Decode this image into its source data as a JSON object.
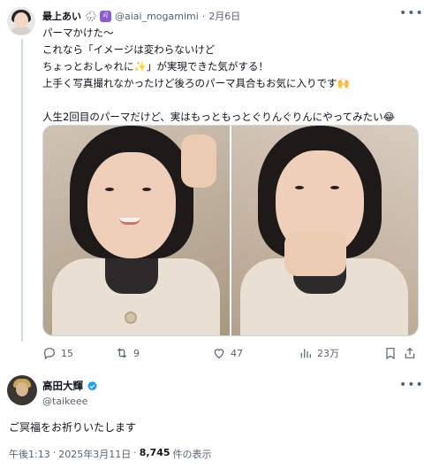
{
  "post": {
    "display_name": "最上あい",
    "emoji_a": "🌧",
    "emoji_b": "♌",
    "handle": "@aiai_mogamimi",
    "separator": "·",
    "date": "2月6日",
    "lines": [
      "パーマかけた〜",
      "これなら「イメージは変わらないけど",
      "ちょっとおしゃれに✨」が実現できた気がする！",
      "上手く写真撮れなかったけど後ろのパーマ具合もお気に入りです🙌",
      "",
      "人生2回目のパーマだけど、実はもっともっとぐりんぐりんにやってみたい😂"
    ],
    "more_icon": "more-horizontal-icon"
  },
  "actions": {
    "reply_count": "15",
    "retweet_count": "9",
    "like_count": "47",
    "views_count": "23万"
  },
  "reply": {
    "display_name": "高田大輝",
    "handle": "@taikeee",
    "text": "ご冥福をお祈りいたします",
    "time": "午後1:13",
    "separator": "·",
    "date": "2025年3月11日",
    "views_number": "8,745",
    "views_label": "件の表示"
  },
  "colors": {
    "text": "#0f1419",
    "muted": "#536471",
    "verified": "#1d9bf0",
    "divider": "#cfd9de"
  }
}
